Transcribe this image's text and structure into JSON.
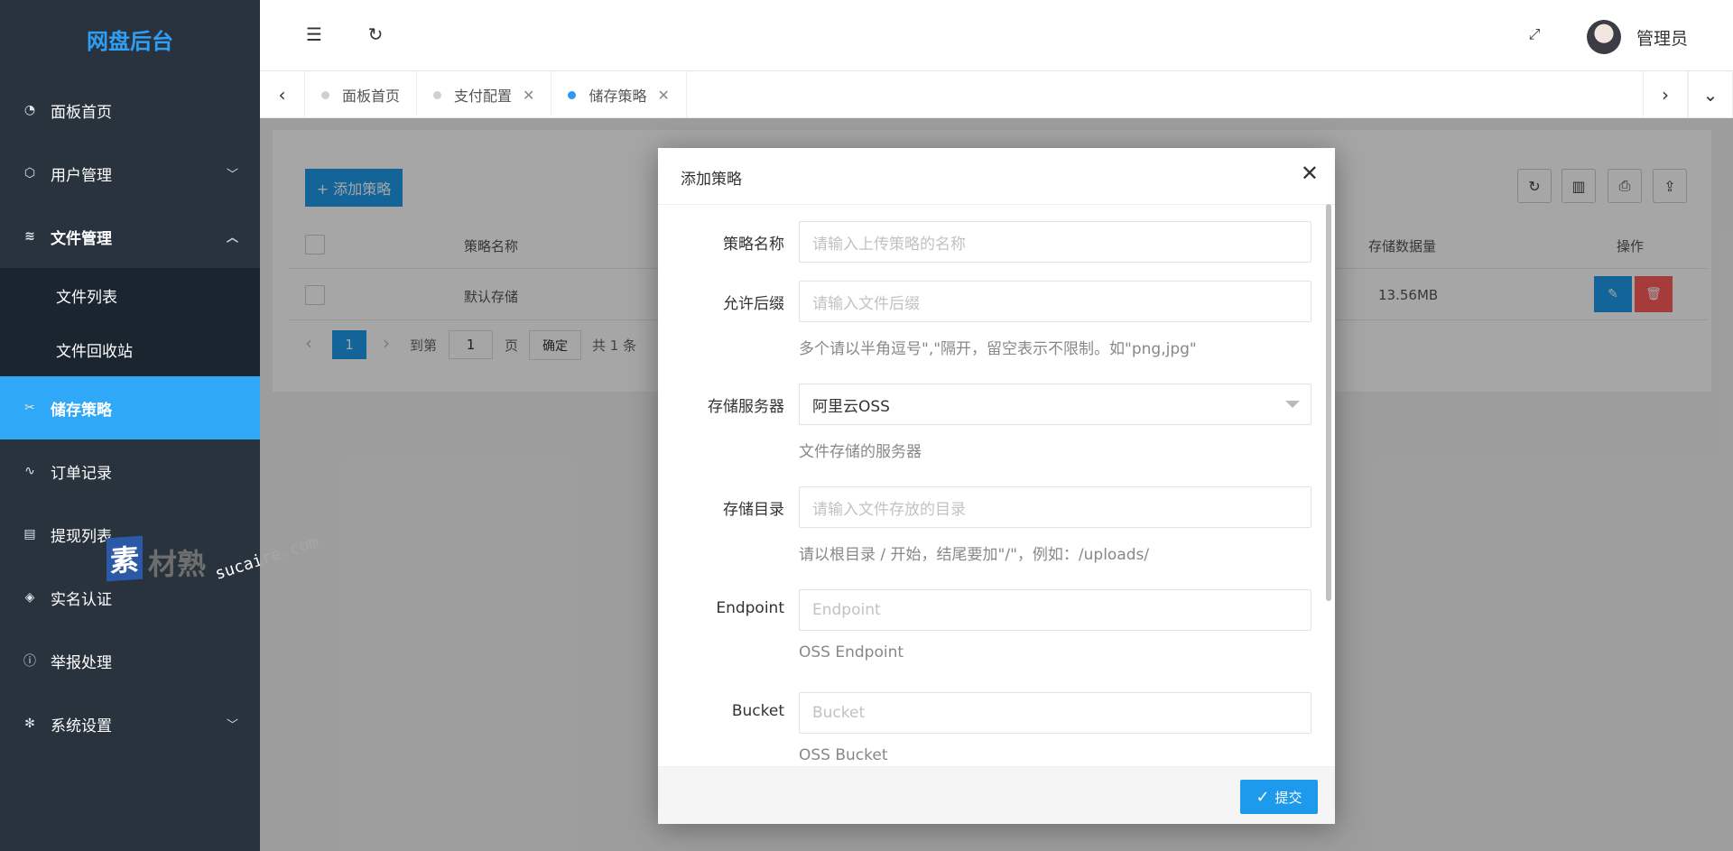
{
  "sidebar": {
    "logo": "网盘后台",
    "items": [
      {
        "label": "面板首页",
        "icon": "dashboard-icon"
      },
      {
        "label": "用户管理",
        "icon": "cube-icon"
      },
      {
        "label": "文件管理",
        "icon": "layers-icon"
      },
      {
        "label": "储存策略",
        "icon": "tools-icon"
      },
      {
        "label": "订单记录",
        "icon": "pulse-icon"
      },
      {
        "label": "提现列表",
        "icon": "clipboard-icon"
      },
      {
        "label": "实名认证",
        "icon": "shield-check-icon"
      },
      {
        "label": "举报处理",
        "icon": "info-icon"
      },
      {
        "label": "系统设置",
        "icon": "gear-icon"
      }
    ],
    "sub_items": [
      "文件列表",
      "文件回收站"
    ]
  },
  "watermark": {
    "seal": "素",
    "brand": "材熟",
    "url": "sucaire.com"
  },
  "header": {
    "user": "管理员"
  },
  "tabs": [
    {
      "label": "面板首页",
      "closable": false
    },
    {
      "label": "支付配置",
      "closable": true
    },
    {
      "label": "储存策略",
      "closable": true,
      "active": true
    }
  ],
  "toolbar": {
    "add_label": "+ 添加策略"
  },
  "table": {
    "headers": {
      "name": "策略名称",
      "size": "存储数据量",
      "ops": "操作"
    },
    "rows": [
      {
        "name": "默认存储",
        "size": "13.56MB"
      }
    ]
  },
  "pager": {
    "page": "1",
    "goto": "到第",
    "input": "1",
    "page_unit": "页",
    "ok": "确定",
    "total": "共 1 条"
  },
  "modal": {
    "title": "添加策略",
    "fields": [
      {
        "label": "策略名称",
        "placeholder": "请输入上传策略的名称"
      },
      {
        "label": "允许后缀",
        "placeholder": "请输入文件后缀",
        "hint": "多个请以半角逗号\",\"隔开，留空表示不限制。如\"png,jpg\""
      },
      {
        "label": "存储服务器",
        "value": "阿里云OSS",
        "hint": "文件存储的服务器"
      },
      {
        "label": "存储目录",
        "placeholder": "请输入文件存放的目录",
        "hint": "请以根目录 / 开始，结尾要加\"/\"，例如：/uploads/"
      },
      {
        "label": "Endpoint",
        "placeholder": "Endpoint",
        "hint": "OSS Endpoint"
      },
      {
        "label": "Bucket",
        "placeholder": "Bucket",
        "hint": "OSS Bucket"
      }
    ],
    "submit": "提交"
  },
  "colors": {
    "accent": "#1e9aec",
    "sidebar_bg": "#28333e",
    "active_nav": "#2ea8f7",
    "danger": "#ff5b5b"
  }
}
